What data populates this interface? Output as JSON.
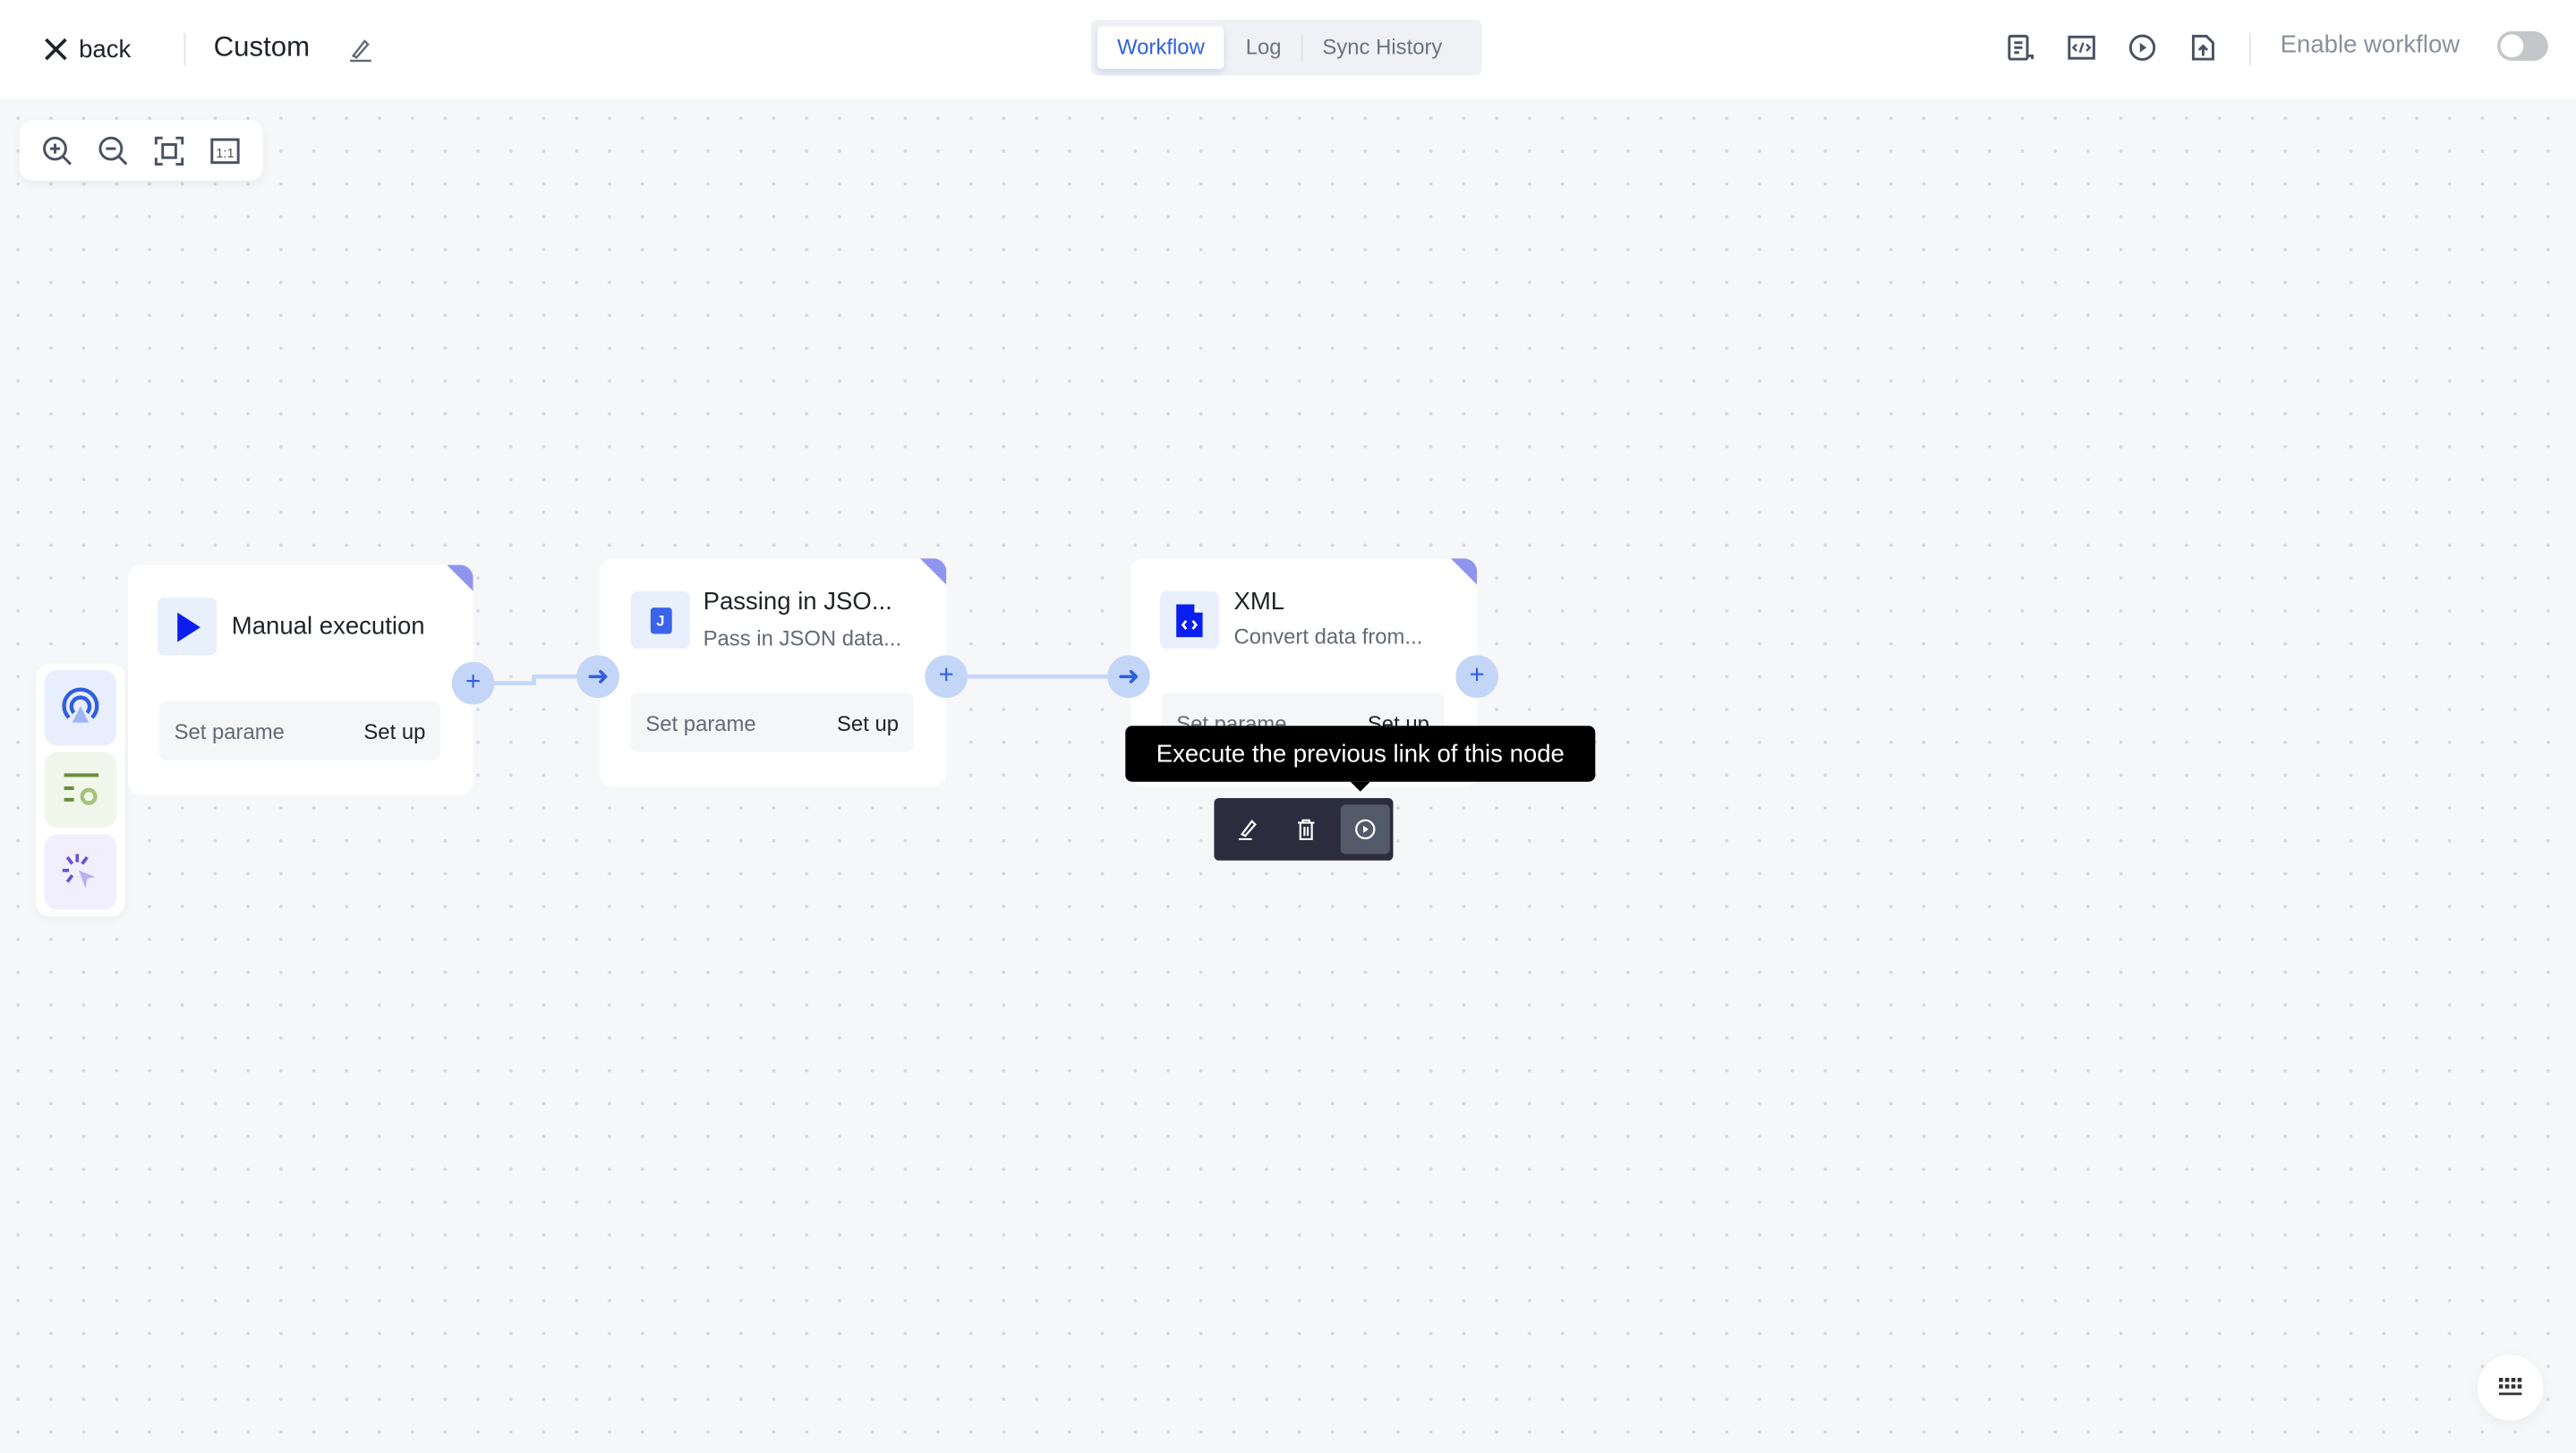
{
  "header": {
    "back_label": "back",
    "title": "Custom",
    "tabs": [
      {
        "label": "Workflow",
        "active": true
      },
      {
        "label": "Log"
      },
      {
        "label": "Sync History"
      }
    ],
    "actions": [
      "document-icon",
      "code-icon",
      "play-icon",
      "upload-file-icon"
    ],
    "enable_label": "Enable workflow",
    "enabled": false
  },
  "zoom_toolbar": [
    "zoom-in-icon",
    "zoom-out-icon",
    "fit-view-icon",
    "actual-size-icon"
  ],
  "palette": [
    "trigger-icon",
    "settings-list-icon",
    "click-icon"
  ],
  "nodes": [
    {
      "title": "Manual execution",
      "subtitle": "",
      "param_label": "Set parame",
      "param_action": "Set up"
    },
    {
      "title": "Passing in JSO...",
      "subtitle": "Pass in JSON data...",
      "param_label": "Set parame",
      "param_action": "Set up",
      "icon_letter": "J"
    },
    {
      "title": "XML",
      "subtitle": "Convert data from...",
      "param_label": "Set parame",
      "param_action": "Set up"
    }
  ],
  "tooltip": "Execute the previous link of this node",
  "colors": {
    "accent": "#2f5fe0",
    "port": "#c4d6f7",
    "corner": "#8f94ee",
    "toolbar": "#2b2d3e"
  }
}
